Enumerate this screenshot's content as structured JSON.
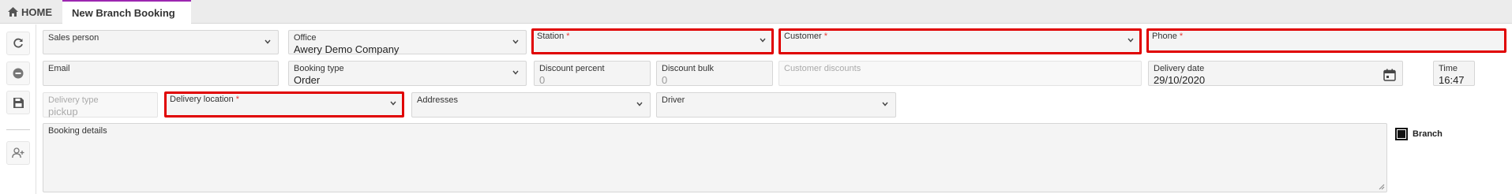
{
  "tabs": {
    "home_label": "HOME",
    "active_label": "New Branch Booking"
  },
  "sidebar": {
    "buttons": [
      {
        "icon": "refresh-icon"
      },
      {
        "icon": "minus-circle-icon"
      },
      {
        "icon": "save-icon"
      },
      {
        "icon": "add-user-icon"
      }
    ]
  },
  "form": {
    "sales_person": {
      "label": "Sales person",
      "value": ""
    },
    "office": {
      "label": "Office",
      "value": "Awery Demo Company"
    },
    "station": {
      "label": "Station",
      "required": "*",
      "value": ""
    },
    "customer": {
      "label": "Customer",
      "required": "*",
      "value": ""
    },
    "phone": {
      "label": "Phone",
      "required": "*",
      "value": ""
    },
    "email": {
      "label": "Email",
      "value": ""
    },
    "booking_type": {
      "label": "Booking type",
      "value": "Order"
    },
    "discount_percent": {
      "label": "Discount percent",
      "value": "0"
    },
    "discount_bulk": {
      "label": "Discount bulk",
      "value": "0"
    },
    "customer_discounts": {
      "label": "Customer discounts",
      "value": ""
    },
    "delivery_date": {
      "label": "Delivery date",
      "value": "29/10/2020"
    },
    "time": {
      "label": "Time",
      "value": "16:47"
    },
    "delivery_type": {
      "label": "Delivery type",
      "value": "pickup"
    },
    "delivery_location": {
      "label": "Delivery location",
      "required": "*",
      "value": ""
    },
    "addresses": {
      "label": "Addresses",
      "value": ""
    },
    "driver": {
      "label": "Driver",
      "value": ""
    },
    "booking_details": {
      "label": "Booking details",
      "value": ""
    },
    "branch_checkbox": {
      "label": "Branch",
      "checked": true
    }
  },
  "colors": {
    "error_border": "#e00000",
    "required_star": "#e53935",
    "active_tab_accent": "#9c27b0"
  }
}
